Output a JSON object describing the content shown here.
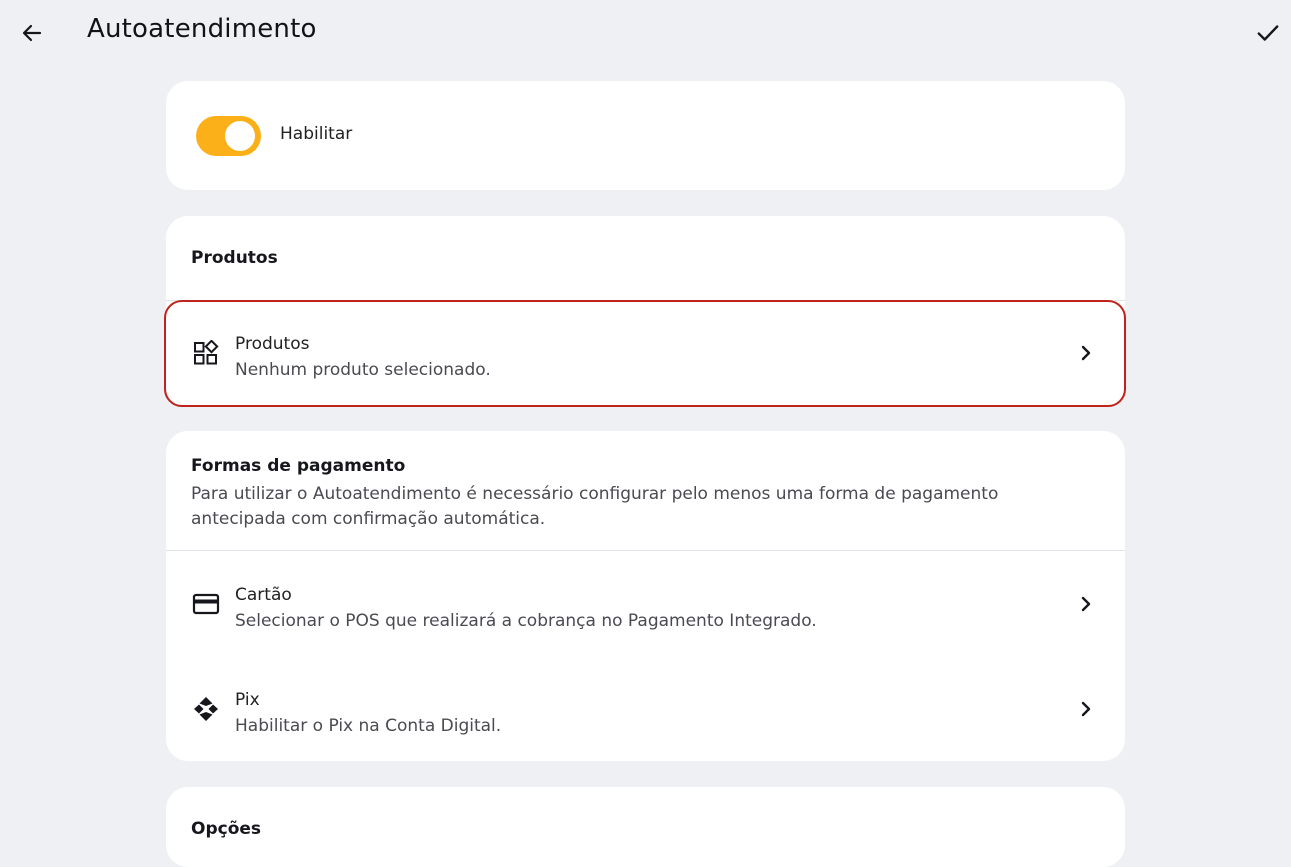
{
  "header": {
    "title": "Autoatendimento",
    "back_icon": "arrow-left-icon",
    "confirm_icon": "check-icon"
  },
  "enable": {
    "label": "Habilitar",
    "toggle_on": true,
    "accent_color": "#fbb01a"
  },
  "products": {
    "section_title": "Produtos",
    "item": {
      "icon": "widgets-icon",
      "title": "Produtos",
      "subtitle": "Nenhum produto selecionado."
    },
    "highlight_color": "#c0221c"
  },
  "payments": {
    "section_title": "Formas de pagamento",
    "description": "Para utilizar o Autoatendimento é necessário configurar pelo menos uma forma de pagamento antecipada com confirmação automática.",
    "items": [
      {
        "icon": "credit-card-icon",
        "title": "Cartão",
        "subtitle": "Selecionar o POS que realizará a cobrança no Pagamento Integrado."
      },
      {
        "icon": "pix-icon",
        "title": "Pix",
        "subtitle": "Habilitar o Pix na Conta Digital."
      }
    ]
  },
  "options": {
    "section_title": "Opções"
  }
}
